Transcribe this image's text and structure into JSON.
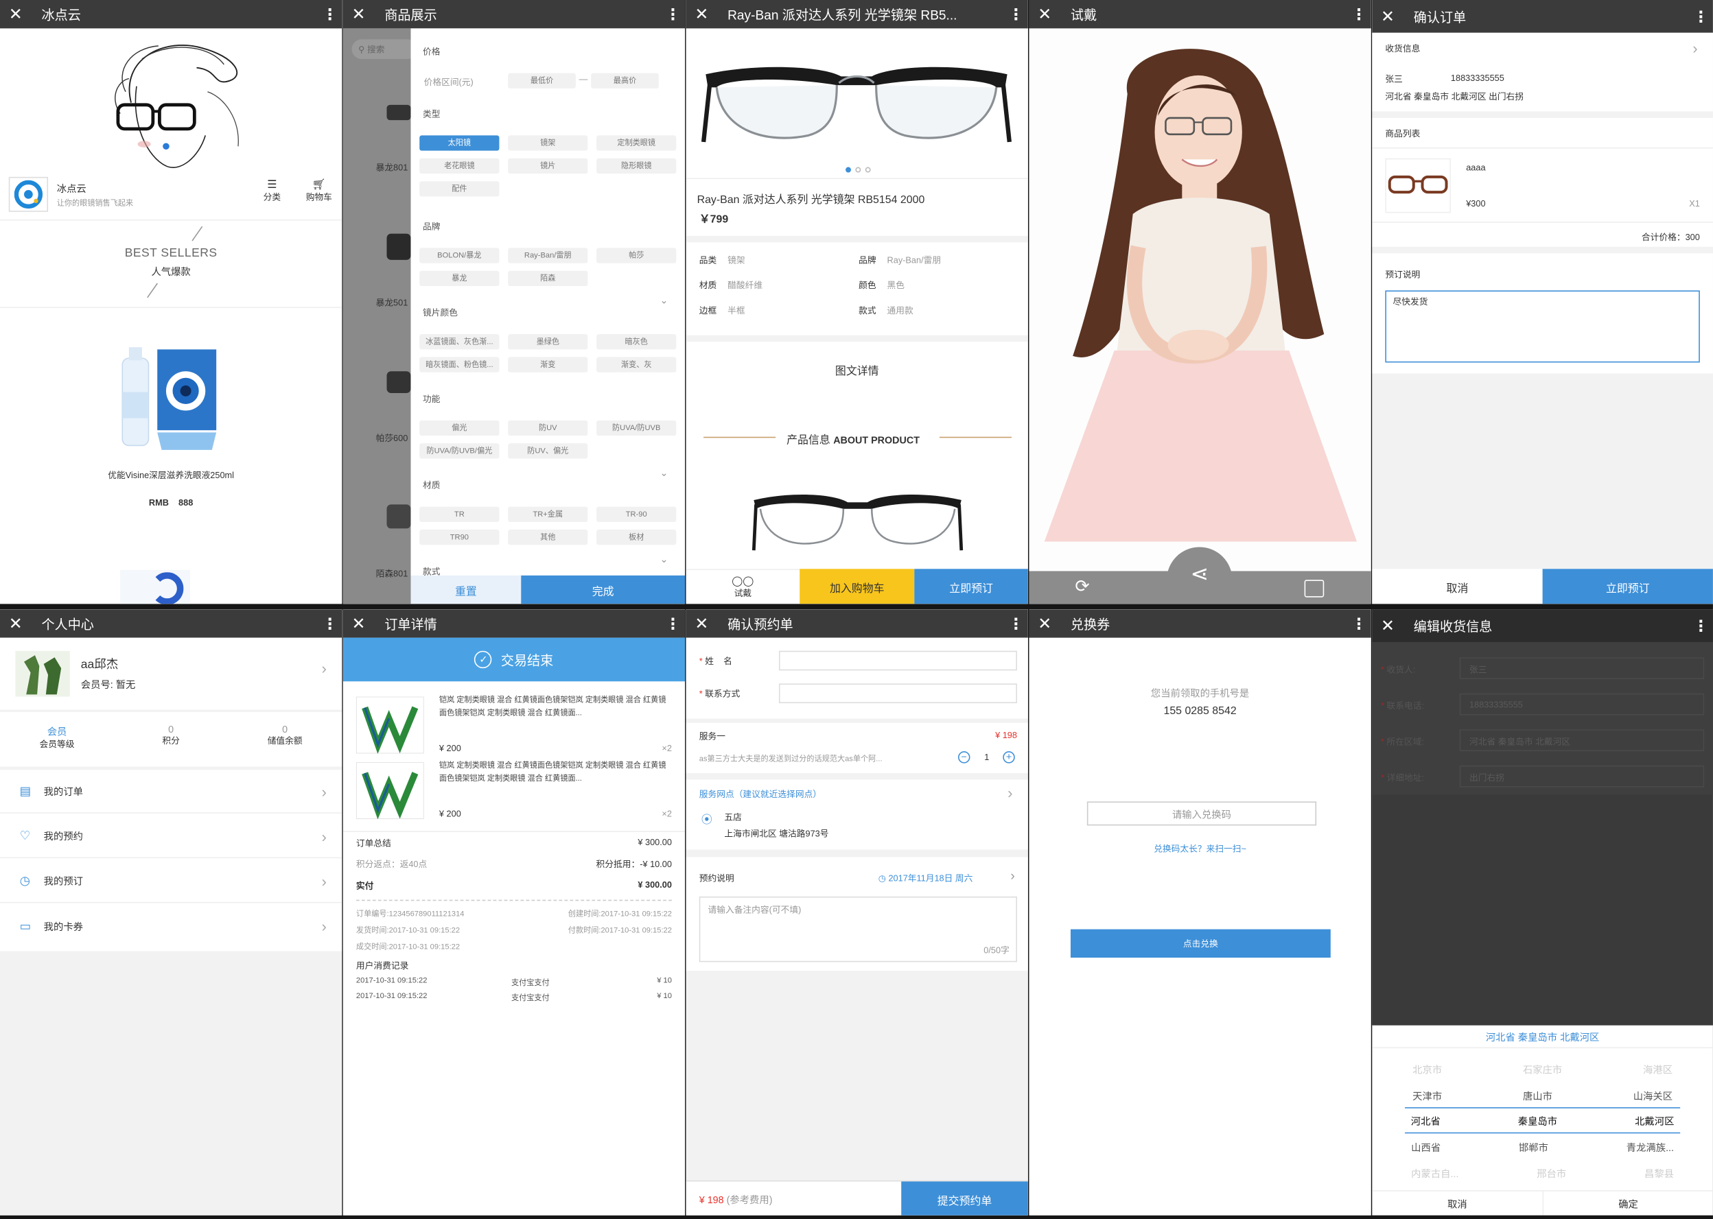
{
  "colors": {
    "accent": "#3d8fd8",
    "titlebar": "#3b3b3b",
    "price_red": "#e8312b",
    "cart_yellow": "#f8c51c"
  },
  "p1": {
    "title": "冰点云",
    "shop_name": "冰点云",
    "shop_slogan": "让你的眼镜销售飞起来",
    "nav_category": "分类",
    "nav_cart": "购物车",
    "best_en": "BEST SELLERS",
    "best_cn": "人气爆款",
    "product_name": "优能Visine深层滋养洗眼液250ml",
    "product_price_label": "RMB",
    "product_price": "888"
  },
  "p2": {
    "title": "商品展示",
    "search_placeholder": "搜索",
    "side_labels": [
      "暴龙801",
      "暴龙501",
      "帕莎600",
      "陌森801"
    ],
    "price_label": "价格",
    "price_range": "价格区间(元)",
    "price_min": "最低价",
    "price_max": "最高价",
    "type_label": "类型",
    "types": [
      "太阳镜",
      "镜架",
      "定制类眼镜",
      "老花眼镜",
      "镜片",
      "隐形眼镜",
      "配件"
    ],
    "brand_label": "品牌",
    "brands": [
      "BOLON/暴龙",
      "Ray-Ban/雷朋",
      "帕莎",
      "暴龙",
      "陌森"
    ],
    "lens_color_label": "镜片颜色",
    "lens_colors": [
      "冰蓝镜面、灰色渐...",
      "墨绿色",
      "暗灰色",
      "暗灰镜面、粉色镜...",
      "渐变",
      "渐变、灰"
    ],
    "func_label": "功能",
    "funcs": [
      "偏光",
      "防UV",
      "防UVA/防UVB",
      "防UVA/防UVB/偏光",
      "防UV、偏光"
    ],
    "material_label": "材质",
    "materials": [
      "TR",
      "TR+金属",
      "TR-90",
      "TR90",
      "其他",
      "板材"
    ],
    "style_label": "款式",
    "reset": "重置",
    "done": "完成"
  },
  "p3": {
    "title": "Ray-Ban 派对达人系列 光学镜架 RB5...",
    "product_title": "Ray-Ban 派对达人系列 光学镜架 RB5154 2000",
    "price": "￥799",
    "specs": [
      {
        "k": "品类",
        "v": "镜架"
      },
      {
        "k": "品牌",
        "v": "Ray-Ban/雷朋"
      },
      {
        "k": "材质",
        "v": "醋酸纤维"
      },
      {
        "k": "颜色",
        "v": "黑色"
      },
      {
        "k": "边框",
        "v": "半框"
      },
      {
        "k": "款式",
        "v": "通用款"
      }
    ],
    "detail_label": "图文详情",
    "about_cn": "产品信息",
    "about_en": "ABOUT PRODUCT",
    "try_on": "试戴",
    "add_cart": "加入购物车",
    "order_now": "立即预订"
  },
  "p4": {
    "title": "试戴"
  },
  "p5": {
    "title": "确认订单",
    "recv_label": "收货信息",
    "recv_name": "张三",
    "recv_phone": "18833335555",
    "recv_addr": "河北省 秦皇岛市 北戴河区 出门右拐",
    "list_label": "商品列表",
    "item_name": "aaaa",
    "item_price": "¥300",
    "item_qty": "X1",
    "total": "合计价格：300",
    "note_label": "预订说明",
    "note_value": "尽快发货",
    "cancel": "取消",
    "order_now": "立即预订"
  },
  "p6": {
    "title": "个人中心",
    "user_name": "aa邱杰",
    "member_no": "会员号: 暂无",
    "stats": [
      {
        "value": "会员",
        "label": "会员等级"
      },
      {
        "value": "0",
        "label": "积分"
      },
      {
        "value": "0",
        "label": "储值余额"
      }
    ],
    "menu": [
      "我的订单",
      "我的预约",
      "我的预订",
      "我的卡券"
    ]
  },
  "p7": {
    "title": "订单详情",
    "status": "交易结束",
    "items": [
      {
        "desc": "铠岚 定制类眼镜 混合 红黄镜面色镜架铠岚 定制类眼镜 混合 红黄镜面色镜架铠岚 定制类眼镜 混合 红黄镜面...",
        "price": "¥ 200",
        "qty": "×2"
      },
      {
        "desc": "铠岚 定制类眼镜 混合 红黄镜面色镜架铠岚 定制类眼镜 混合 红黄镜面色镜架铠岚 定制类眼镜 混合 红黄镜面...",
        "price": "¥ 200",
        "qty": "×2"
      }
    ],
    "total_label": "订单总结",
    "total_value": "¥ 300.00",
    "points_back": "积分返点：返40点",
    "points_used": "积分抵用：-¥ 10.00",
    "paid_label": "实付",
    "paid_value": "¥ 300.00",
    "order_no": "订单编号:123456789011121314",
    "created": "创建时间:2017-10-31 09:15:22",
    "shipped": "发货时间:2017-10-31 09:15:22",
    "paid_time": "付款时间:2017-10-31 09:15:22",
    "done_time": "成交时间:2017-10-31 09:15:22",
    "records_label": "用户消费记录",
    "records": [
      {
        "time": "2017-10-31 09:15:22",
        "method": "支付宝支付",
        "amount": "¥ 10"
      },
      {
        "time": "2017-10-31 09:15:22",
        "method": "支付宝支付",
        "amount": "¥ 10"
      }
    ]
  },
  "p8": {
    "title": "确认预约单",
    "name_label": "姓    名",
    "contact_label": "联系方式",
    "service_label": "服务一",
    "service_price": "¥ 198",
    "service_desc": "as第三方士大夫是的发送到过分的话规范大as单个阿...",
    "qty": "1",
    "outlet_label": "服务网点（建议就近选择网点）",
    "outlet_name": "五店",
    "outlet_addr": "上海市闸北区 塘沽路973号",
    "note_label": "预约说明",
    "date": "2017年11月18日 周六",
    "note_placeholder": "请输入备注内容(可不填)",
    "note_count": "0/50字",
    "footer_price": "¥ 198",
    "footer_hint": "(参考费用)",
    "submit": "提交预约单"
  },
  "p9": {
    "title": "兑换券",
    "phone_hint": "您当前领取的手机号是",
    "phone": "155 0285 8542",
    "code_placeholder": "请输入兑换码",
    "scan_hint": "兑换码太长？来扫一扫~",
    "redeem": "点击兑换"
  },
  "p10": {
    "title": "编辑收货信息",
    "fields": [
      {
        "label": "收货人:",
        "value": "张三"
      },
      {
        "label": "联系电话:",
        "value": "18833335555"
      },
      {
        "label": "所在区域:",
        "value": "河北省 秦皇岛市 北戴河区"
      },
      {
        "label": "详细地址:",
        "value": "出门右拐"
      }
    ],
    "picker_title": "河北省 秦皇岛市 北戴河区",
    "picker_rows": [
      [
        "北京市",
        "石家庄市",
        "海港区"
      ],
      [
        "天津市",
        "唐山市",
        "山海关区"
      ],
      [
        "河北省",
        "秦皇岛市",
        "北戴河区"
      ],
      [
        "山西省",
        "邯郸市",
        "青龙满族..."
      ],
      [
        "内蒙古自...",
        "邢台市",
        "昌黎县"
      ]
    ],
    "cancel": "取消",
    "confirm": "确定"
  }
}
